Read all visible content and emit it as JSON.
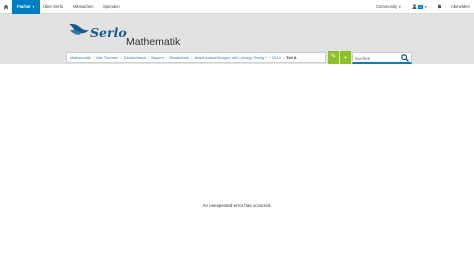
{
  "nav": {
    "faecher": "Fächer",
    "ueber": "Über Serlo",
    "mitmachen": "Mitmachen",
    "spenden": "Spenden",
    "community": "Community",
    "notifications": "0",
    "logout": "Abmelden"
  },
  "header": {
    "logo_text": "Serlo",
    "subject": "Mathematik"
  },
  "breadcrumb": {
    "items": [
      "Mathematik",
      "Alle Themen",
      "Deutschland",
      "Bayern",
      "Realschule",
      "Abschlussprüfungen mit Lösung: Zweig I",
      "2019"
    ],
    "current": "Teil A"
  },
  "search": {
    "placeholder": "Suchen"
  },
  "error_message": "An unexpected error has occurred.",
  "colors": {
    "accent": "#007ec1",
    "edit_green": "#8dbf2e",
    "header_bg": "#e2e2e2"
  }
}
